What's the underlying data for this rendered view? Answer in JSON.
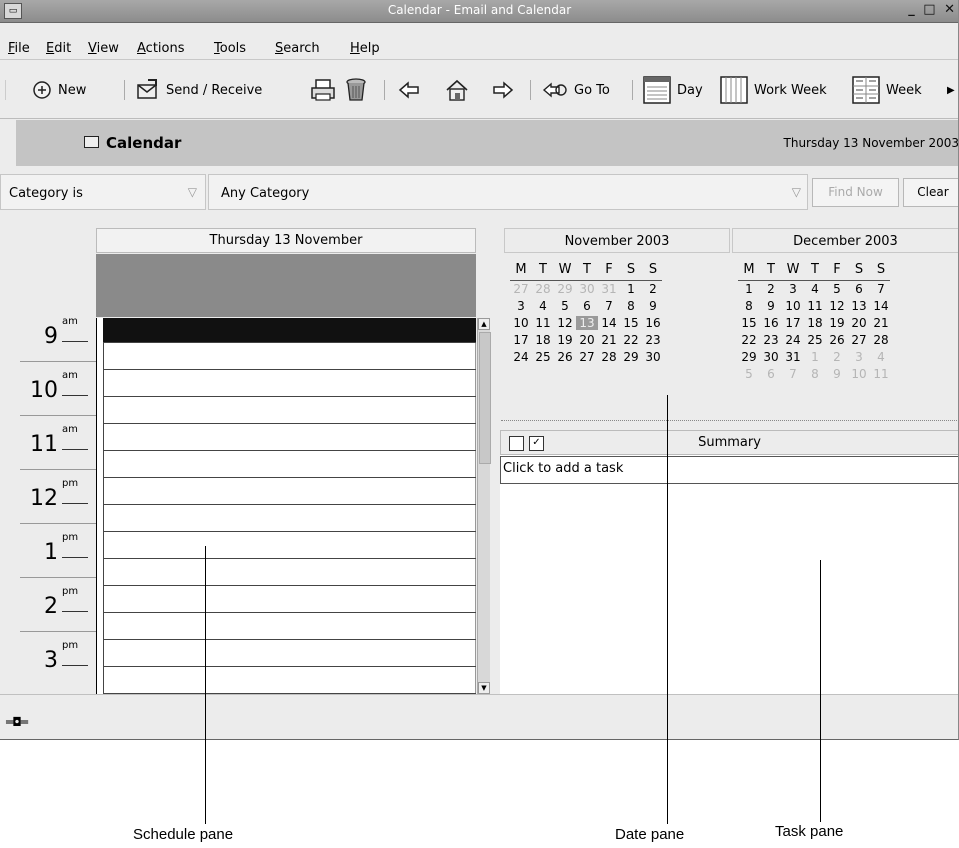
{
  "window": {
    "title": "Calendar - Email and Calendar"
  },
  "menu": {
    "items": [
      {
        "label": "File",
        "ul": "F"
      },
      {
        "label": "Edit",
        "ul": "E"
      },
      {
        "label": "View",
        "ul": "V"
      },
      {
        "label": "Actions",
        "ul": "A"
      },
      {
        "label": "Tools",
        "ul": "T"
      },
      {
        "label": "Search",
        "ul": "S"
      },
      {
        "label": "Help",
        "ul": "H"
      }
    ]
  },
  "toolbar": {
    "new_label": "New",
    "send_receive_label": "Send / Receive",
    "goto_label": "Go To",
    "day_label": "Day",
    "work_week_label": "Work Week",
    "week_label": "Week",
    "icons": [
      "calendar-new-icon",
      "send-receive-icon",
      "print-icon",
      "delete-icon",
      "back-arrow-icon",
      "home-icon",
      "forward-arrow-icon",
      "goto-icon",
      "day-view-icon",
      "work-week-view-icon",
      "week-view-icon",
      "more-arrow-icon"
    ]
  },
  "calendar_header": {
    "title": "Calendar",
    "date": "Thursday 13 November 2003"
  },
  "search": {
    "category_filter": "Category is",
    "category_value": "Any Category",
    "find_now_label": "Find Now",
    "clear_label": "Clear"
  },
  "schedule": {
    "day_header": "Thursday 13 November",
    "hours": [
      {
        "num": "9",
        "suffix": "am"
      },
      {
        "num": "10",
        "suffix": "am"
      },
      {
        "num": "11",
        "suffix": "am"
      },
      {
        "num": "12",
        "suffix": "pm"
      },
      {
        "num": "1",
        "suffix": "pm"
      },
      {
        "num": "2",
        "suffix": "pm"
      },
      {
        "num": "3",
        "suffix": "pm"
      }
    ]
  },
  "date_pane": {
    "months": [
      {
        "title": "November 2003",
        "weekdays": [
          "M",
          "T",
          "W",
          "T",
          "F",
          "S",
          "S"
        ],
        "weeks": [
          [
            {
              "d": "27",
              "m": 1
            },
            {
              "d": "28",
              "m": 1
            },
            {
              "d": "29",
              "m": 1
            },
            {
              "d": "30",
              "m": 1
            },
            {
              "d": "31",
              "m": 1
            },
            {
              "d": "1"
            },
            {
              "d": "2"
            }
          ],
          [
            {
              "d": "3"
            },
            {
              "d": "4"
            },
            {
              "d": "5"
            },
            {
              "d": "6"
            },
            {
              "d": "7"
            },
            {
              "d": "8"
            },
            {
              "d": "9"
            }
          ],
          [
            {
              "d": "10"
            },
            {
              "d": "11"
            },
            {
              "d": "12"
            },
            {
              "d": "13",
              "today": 1
            },
            {
              "d": "14"
            },
            {
              "d": "15"
            },
            {
              "d": "16"
            }
          ],
          [
            {
              "d": "17"
            },
            {
              "d": "18"
            },
            {
              "d": "19"
            },
            {
              "d": "20"
            },
            {
              "d": "21"
            },
            {
              "d": "22"
            },
            {
              "d": "23"
            }
          ],
          [
            {
              "d": "24"
            },
            {
              "d": "25"
            },
            {
              "d": "26"
            },
            {
              "d": "27"
            },
            {
              "d": "28"
            },
            {
              "d": "29"
            },
            {
              "d": "30"
            }
          ]
        ]
      },
      {
        "title": "December 2003",
        "weekdays": [
          "M",
          "T",
          "W",
          "T",
          "F",
          "S",
          "S"
        ],
        "weeks": [
          [
            {
              "d": "1"
            },
            {
              "d": "2"
            },
            {
              "d": "3"
            },
            {
              "d": "4"
            },
            {
              "d": "5"
            },
            {
              "d": "6"
            },
            {
              "d": "7"
            }
          ],
          [
            {
              "d": "8"
            },
            {
              "d": "9"
            },
            {
              "d": "10"
            },
            {
              "d": "11"
            },
            {
              "d": "12"
            },
            {
              "d": "13"
            },
            {
              "d": "14"
            }
          ],
          [
            {
              "d": "15"
            },
            {
              "d": "16"
            },
            {
              "d": "17"
            },
            {
              "d": "18"
            },
            {
              "d": "19"
            },
            {
              "d": "20"
            },
            {
              "d": "21"
            }
          ],
          [
            {
              "d": "22"
            },
            {
              "d": "23"
            },
            {
              "d": "24"
            },
            {
              "d": "25"
            },
            {
              "d": "26"
            },
            {
              "d": "27"
            },
            {
              "d": "28"
            }
          ],
          [
            {
              "d": "29"
            },
            {
              "d": "30"
            },
            {
              "d": "31"
            },
            {
              "d": "1",
              "m": 1
            },
            {
              "d": "2",
              "m": 1
            },
            {
              "d": "3",
              "m": 1
            },
            {
              "d": "4",
              "m": 1
            }
          ],
          [
            {
              "d": "5",
              "m": 1
            },
            {
              "d": "6",
              "m": 1
            },
            {
              "d": "7",
              "m": 1
            },
            {
              "d": "8",
              "m": 1
            },
            {
              "d": "9",
              "m": 1
            },
            {
              "d": "10",
              "m": 1
            },
            {
              "d": "11",
              "m": 1
            }
          ]
        ]
      }
    ]
  },
  "task_pane": {
    "summary_header": "Summary",
    "add_task_placeholder": "Click to add a task"
  },
  "callouts": {
    "schedule": "Schedule pane",
    "date": "Date pane",
    "task": "Task pane"
  },
  "colors": {
    "window_bg": "#ececec",
    "header_bg": "#c4c4c4",
    "selection": "#111111",
    "today_highlight": "#9a9a9a"
  }
}
